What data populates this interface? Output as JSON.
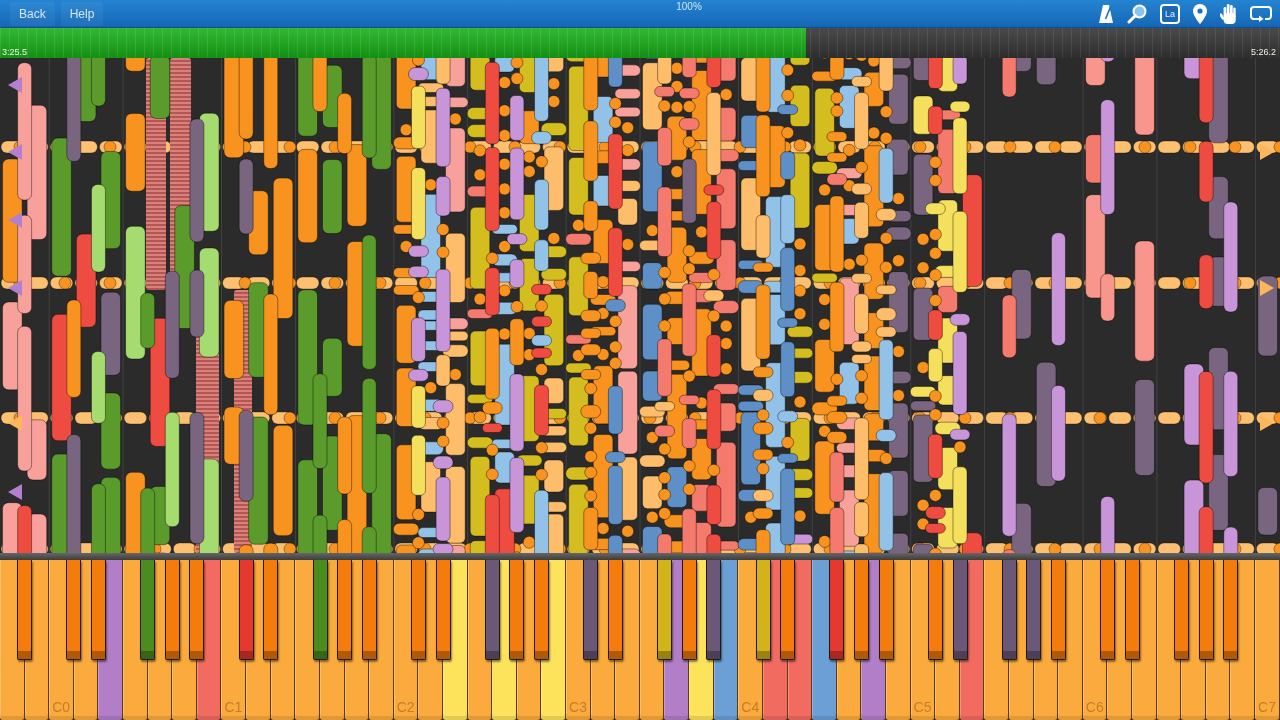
{
  "toolbar": {
    "buttons": [
      "Back",
      "Help"
    ],
    "speed": "100%",
    "labels_button": "La"
  },
  "progress": {
    "level": 0.63,
    "elapsed": "3:25.5",
    "total": "5:26.2"
  },
  "keyboard": {
    "white_keys": [
      {
        "color": "#fbab3d"
      },
      {
        "color": "#fbab3d"
      },
      {
        "label": "C0",
        "color": "#fbab3d"
      },
      {
        "color": "#fbab3d"
      },
      {
        "color": "#b27ec8"
      },
      {
        "color": "#fbab3d"
      },
      {
        "color": "#fbab3d"
      },
      {
        "color": "#fbab3d"
      },
      {
        "color": "#f26b60"
      },
      {
        "label": "C1",
        "color": "#fbab3d"
      },
      {
        "color": "#fbab3d"
      },
      {
        "color": "#fbab3d"
      },
      {
        "color": "#fbab3d"
      },
      {
        "color": "#fbab3d"
      },
      {
        "color": "#fbab3d"
      },
      {
        "color": "#fbab3d"
      },
      {
        "label": "C2",
        "color": "#fbab3d"
      },
      {
        "color": "#fbab3d"
      },
      {
        "color": "#fde35c"
      },
      {
        "color": "#fbab3d"
      },
      {
        "color": "#fde35c"
      },
      {
        "color": "#fbab3d"
      },
      {
        "color": "#fde35c"
      },
      {
        "label": "C3",
        "color": "#fbab3d"
      },
      {
        "color": "#fbab3d"
      },
      {
        "color": "#fbab3d"
      },
      {
        "color": "#fbab3d"
      },
      {
        "color": "#b27ec8"
      },
      {
        "color": "#fde35c"
      },
      {
        "color": "#6b9fd6"
      },
      {
        "label": "C4",
        "color": "#fbab3d"
      },
      {
        "color": "#f26b60"
      },
      {
        "color": "#f26b60"
      },
      {
        "color": "#6b9fd6"
      },
      {
        "color": "#fbab3d"
      },
      {
        "color": "#b27ec8"
      },
      {
        "color": "#fbab3d"
      },
      {
        "label": "C5",
        "color": "#fbab3d"
      },
      {
        "color": "#fbab3d"
      },
      {
        "color": "#f26b60"
      },
      {
        "color": "#fbab3d"
      },
      {
        "color": "#fbab3d"
      },
      {
        "color": "#fbab3d"
      },
      {
        "color": "#fbab3d"
      },
      {
        "label": "C6",
        "color": "#fbab3d"
      },
      {
        "color": "#fbab3d"
      },
      {
        "color": "#fbab3d"
      },
      {
        "color": "#fbab3d"
      },
      {
        "color": "#fbab3d"
      },
      {
        "color": "#fbab3d"
      },
      {
        "color": "#fbab3d"
      },
      {
        "label": "C7",
        "color": "#fbab3d"
      }
    ],
    "black_keys": [
      {
        "color": "#f47c0c"
      },
      {
        "color": "#f47c0c"
      },
      {
        "color": "#f47c0c"
      },
      {
        "color": "#4a8c1e"
      },
      {
        "color": "#f47c0c"
      },
      {
        "color": "#f47c0c"
      },
      {
        "color": "#e5382e"
      },
      {
        "color": "#f47c0c"
      },
      {
        "color": "#4a8c1e"
      },
      {
        "color": "#f47c0c"
      },
      {
        "color": "#f47c0c"
      },
      {
        "color": "#f47c0c"
      },
      {
        "color": "#f47c0c"
      },
      {
        "color": "#6b5878"
      },
      {
        "color": "#f47c0c"
      },
      {
        "color": "#f47c0c"
      },
      {
        "color": "#6b5878"
      },
      {
        "color": "#f47c0c"
      },
      {
        "color": "#d2b41a"
      },
      {
        "color": "#f47c0c"
      },
      {
        "color": "#6b5878"
      },
      {
        "color": "#d2b41a"
      },
      {
        "color": "#f47c0c"
      },
      {
        "color": "#e5382e"
      },
      {
        "color": "#f47c0c"
      },
      {
        "color": "#f47c0c"
      },
      {
        "color": "#f47c0c"
      },
      {
        "color": "#6b5878"
      },
      {
        "color": "#6b5878"
      },
      {
        "color": "#6b5878"
      },
      {
        "color": "#f47c0c"
      },
      {
        "color": "#f47c0c"
      },
      {
        "color": "#f47c0c"
      },
      {
        "color": "#f47c0c"
      },
      {
        "color": "#f47c0c"
      },
      {
        "color": "#f47c0c"
      }
    ]
  }
}
